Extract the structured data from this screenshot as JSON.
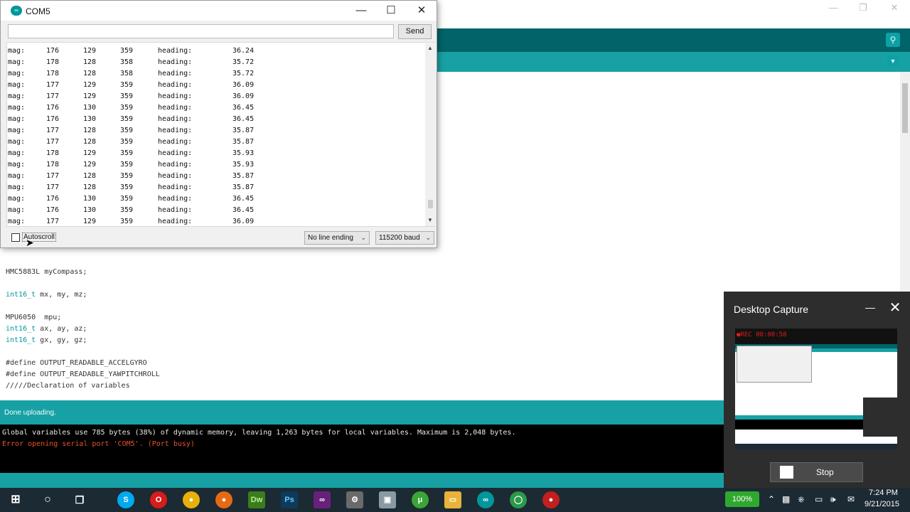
{
  "serial_monitor": {
    "title": "COM5",
    "send_input_value": "",
    "send_label": "Send",
    "rows": [
      {
        "label": "mag:",
        "x": "176",
        "y": "129",
        "z": "359",
        "heading_label": "heading:",
        "heading": "36.24"
      },
      {
        "label": "mag:",
        "x": "178",
        "y": "128",
        "z": "358",
        "heading_label": "heading:",
        "heading": "35.72"
      },
      {
        "label": "mag:",
        "x": "178",
        "y": "128",
        "z": "358",
        "heading_label": "heading:",
        "heading": "35.72"
      },
      {
        "label": "mag:",
        "x": "177",
        "y": "129",
        "z": "359",
        "heading_label": "heading:",
        "heading": "36.09"
      },
      {
        "label": "mag:",
        "x": "177",
        "y": "129",
        "z": "359",
        "heading_label": "heading:",
        "heading": "36.09"
      },
      {
        "label": "mag:",
        "x": "176",
        "y": "130",
        "z": "359",
        "heading_label": "heading:",
        "heading": "36.45"
      },
      {
        "label": "mag:",
        "x": "176",
        "y": "130",
        "z": "359",
        "heading_label": "heading:",
        "heading": "36.45"
      },
      {
        "label": "mag:",
        "x": "177",
        "y": "128",
        "z": "359",
        "heading_label": "heading:",
        "heading": "35.87"
      },
      {
        "label": "mag:",
        "x": "177",
        "y": "128",
        "z": "359",
        "heading_label": "heading:",
        "heading": "35.87"
      },
      {
        "label": "mag:",
        "x": "178",
        "y": "129",
        "z": "359",
        "heading_label": "heading:",
        "heading": "35.93"
      },
      {
        "label": "mag:",
        "x": "178",
        "y": "129",
        "z": "359",
        "heading_label": "heading:",
        "heading": "35.93"
      },
      {
        "label": "mag:",
        "x": "177",
        "y": "128",
        "z": "359",
        "heading_label": "heading:",
        "heading": "35.87"
      },
      {
        "label": "mag:",
        "x": "177",
        "y": "128",
        "z": "359",
        "heading_label": "heading:",
        "heading": "35.87"
      },
      {
        "label": "mag:",
        "x": "176",
        "y": "130",
        "z": "359",
        "heading_label": "heading:",
        "heading": "36.45"
      },
      {
        "label": "mag:",
        "x": "176",
        "y": "130",
        "z": "359",
        "heading_label": "heading:",
        "heading": "36.45"
      },
      {
        "label": "mag:",
        "x": "177",
        "y": "129",
        "z": "359",
        "heading_label": "heading:",
        "heading": "36.09"
      }
    ],
    "autoscroll_label": "Autoscroll",
    "autoscroll_checked": false,
    "line_ending": "No line ending",
    "baud": "115200 baud"
  },
  "editor": {
    "lines": [
      {
        "type": "HMC5883L",
        "rest": " myCompass;",
        "keyword": false
      },
      {
        "type": "int16_t",
        "rest": " mx, my, mz;",
        "keyword": true
      },
      {
        "type": "MPU6050",
        "rest": "  mpu;",
        "keyword": false
      },
      {
        "type": "int16_t",
        "rest": " ax, ay, az;",
        "keyword": true
      },
      {
        "type": "int16_t",
        "rest": " gx, gy, gz;",
        "keyword": true
      },
      {
        "type": "#define",
        "rest": " OUTPUT_READABLE_ACCELGYRO",
        "keyword": false
      },
      {
        "type": "#define",
        "rest": " OUTPUT_READABLE_YAWPITCHROLL",
        "keyword": false
      },
      {
        "type": "/////Declaration of variables",
        "rest": "",
        "keyword": false
      }
    ]
  },
  "status": {
    "message": "Done uploading."
  },
  "console": {
    "info": "Global variables use 785 bytes (38%) of dynamic memory, leaving 1,263 bytes for local variables. Maximum is 2,048 bytes.",
    "error": "Error opening serial port 'COM5'. (Port busy)"
  },
  "capture": {
    "title": "Desktop Capture",
    "rec": "●REC 00:00:58",
    "stop_label": "Stop"
  },
  "taskbar": {
    "battery": "100%",
    "time": "7:24 PM",
    "date": "9/21/2015"
  },
  "colors": {
    "arduino_dark": "#006468",
    "arduino_teal": "#17a1a5",
    "error_text": "#e8532c",
    "rec_red": "#e21b1b"
  }
}
